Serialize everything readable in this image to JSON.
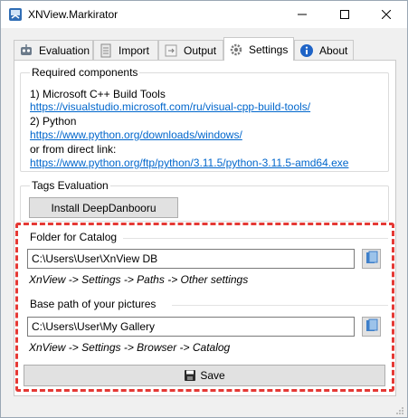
{
  "window": {
    "title": "XNView.Markirator"
  },
  "tabs": [
    {
      "label": "Evaluation",
      "icon": "robot-icon"
    },
    {
      "label": "Import",
      "icon": "import-icon"
    },
    {
      "label": "Output",
      "icon": "output-icon"
    },
    {
      "label": "Settings",
      "icon": "gear-icon"
    },
    {
      "label": "About",
      "icon": "info-icon"
    }
  ],
  "required": {
    "title": "Required components",
    "line1": "1) Microsoft C++ Build Tools",
    "link1": "https://visualstudio.microsoft.com/ru/visual-cpp-build-tools/",
    "line2": "2) Python",
    "link2": "https://www.python.org/downloads/windows/",
    "line3": "or from direct link:",
    "link3": "https://www.python.org/ftp/python/3.11.5/python-3.11.5-amd64.exe"
  },
  "tags": {
    "title": "Tags Evaluation",
    "install_label": "Install DeepDanbooru"
  },
  "catalog": {
    "title": "Folder for Catalog",
    "value": "C:\\Users\\User\\XnView DB",
    "hint": "XnView -> Settings -> Paths -> Other settings"
  },
  "pictures": {
    "title": "Base path of your pictures",
    "value": "C:\\Users\\User\\My Gallery",
    "hint": "XnView -> Settings -> Browser -> Catalog"
  },
  "save_label": "Save",
  "colors": {
    "highlight": "#e53935",
    "link": "#0066cc"
  }
}
